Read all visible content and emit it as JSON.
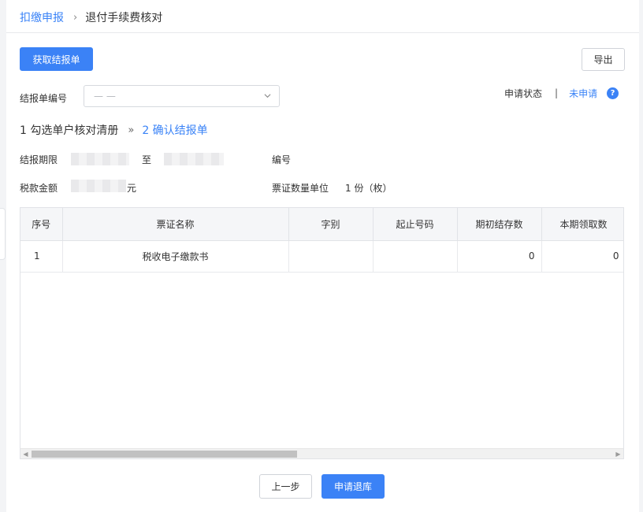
{
  "breadcrumb": {
    "parent": "扣缴申报",
    "separator": "›",
    "current": "退付手续费核对"
  },
  "toolbar": {
    "fetch_label": "获取结报单",
    "export_label": "导出"
  },
  "form": {
    "report_no_label": "结报单编号",
    "report_no_value": "— —"
  },
  "status": {
    "label": "申请状态",
    "separator": "|",
    "value": "未申请",
    "help": "?"
  },
  "steps": {
    "step1": "1 勾选单户核对清册",
    "arrow": "»",
    "step2": "2 确认结报单"
  },
  "info": {
    "period_label": "结报期限",
    "period_to": "至",
    "number_label": "编号",
    "amount_label": "税款金额",
    "amount_unit": "元",
    "quantity_unit_label": "票证数量单位",
    "quantity_unit_value": "1 份（枚）"
  },
  "table": {
    "headers": [
      "序号",
      "票证名称",
      "字别",
      "起止号码",
      "期初结存数",
      "本期领取数"
    ],
    "rows": [
      [
        "1",
        "税收电子缴款书",
        "",
        "",
        "0",
        "0"
      ]
    ]
  },
  "footer": {
    "prev_label": "上一步",
    "apply_label": "申请退库"
  },
  "colors": {
    "primary": "#3b82f6",
    "link": "#3a83f7"
  }
}
